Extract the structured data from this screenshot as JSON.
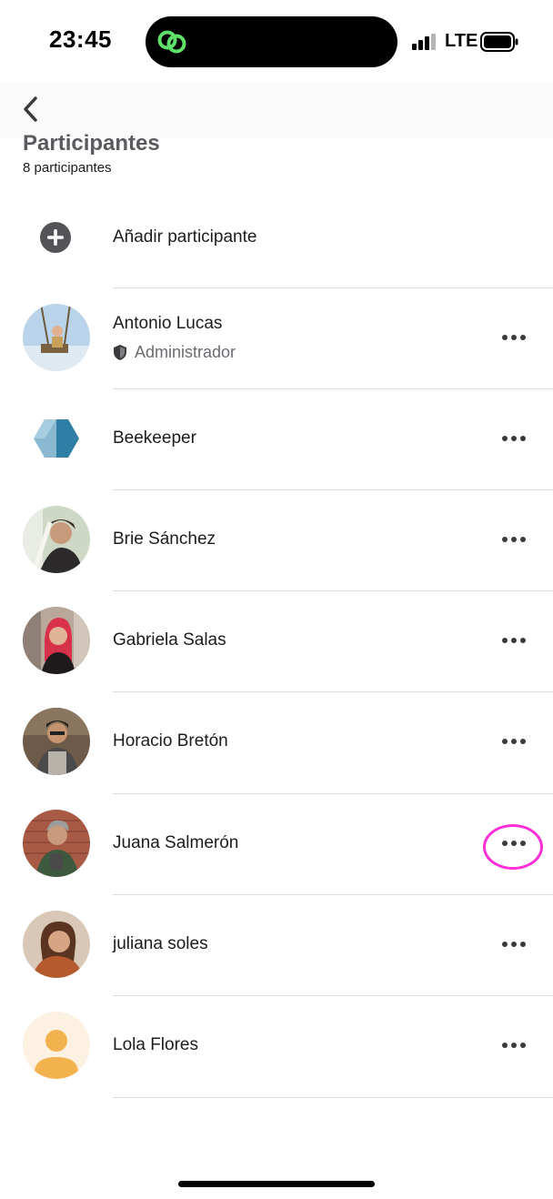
{
  "status_bar": {
    "time": "23:45",
    "network": "LTE",
    "island_icon": "app-link-icon",
    "island_icon_color": "#5fe06a"
  },
  "nav": {
    "back_icon": "chevron-left-icon"
  },
  "header": {
    "title": "Participantes",
    "subtitle": "8 participantes"
  },
  "add_participant": {
    "label": "Añadir participante",
    "icon": "plus-circle-icon"
  },
  "participants": [
    {
      "name": "Antonio Lucas",
      "role": "Administrador",
      "role_icon": "shield-icon",
      "avatar": "photo-swing"
    },
    {
      "name": "Beekeeper",
      "avatar": "beekeeper-hexagon-logo"
    },
    {
      "name": "Brie Sánchez",
      "avatar": "photo-woman-hat"
    },
    {
      "name": "Gabriela Salas",
      "avatar": "photo-woman-red-hair"
    },
    {
      "name": "Horacio Bretón",
      "avatar": "photo-man-apron"
    },
    {
      "name": "Juana Salmerón",
      "avatar": "photo-man-brick-wall",
      "highlighted": true
    },
    {
      "name": "juliana soles",
      "avatar": "photo-woman-smiling"
    },
    {
      "name": "Lola Flores",
      "avatar": "default-person-icon"
    }
  ],
  "colors": {
    "highlight": "#ff2fd6",
    "default_avatar_bg": "#fdf1e2",
    "default_avatar_fg": "#f2b24d",
    "beekeeper_blue": "#3a8fb5"
  }
}
